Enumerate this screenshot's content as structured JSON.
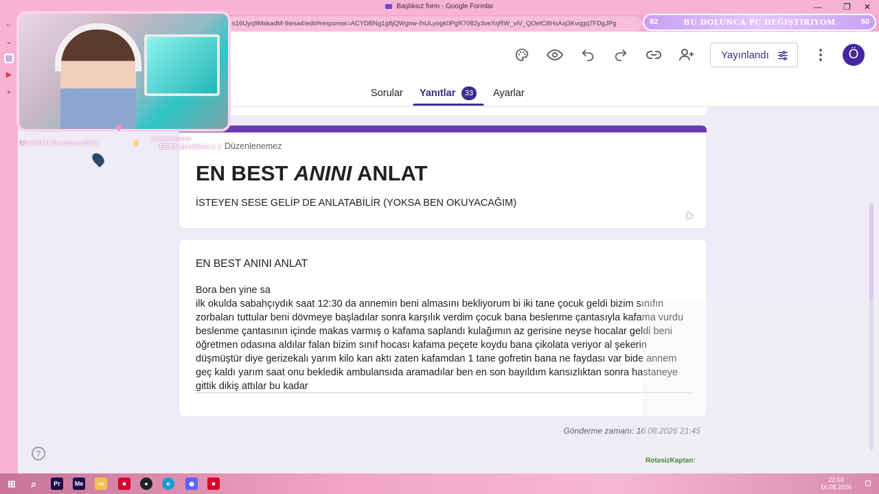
{
  "window": {
    "title": "Başlıksız form - Google Formlar",
    "url": "s16Uyq9MskadM-9iesa4/edit#response=ACYDBNg1g8jQWgnw-IhULyogk0PgR7082y3veXrjRW_viV_QOefC8HsAxj3Kvqgq7FDgJPg"
  },
  "stream_overlay": {
    "goal_left": "82",
    "goal_text": "BU DOLUNCA PC DEĞIŞTIRIYOM",
    "goal_right": "50",
    "label_a": "Abonelik Hediyecisi erenbaha",
    "label_b": "MEKANIN SAHIBI",
    "label_c": "EREN BAHAAA x 1",
    "chat_user": "RotasizKaptan:",
    "chat_msg": "..."
  },
  "toolbar": {
    "publish_label": "Yayınlandı",
    "avatar_letter": "Ö"
  },
  "tabs": {
    "questions": "Sorular",
    "responses": "Yanıtlar",
    "responses_count": "33",
    "settings": "Ayarlar"
  },
  "form": {
    "noneditable_note": "Düzenlenemez",
    "title_part1": "EN BEST ",
    "title_part2": "ANINI",
    "title_part3": " ANLAT",
    "description": "İSTEYEN SESE GELİP DE ANLATABİLİR (YOKSA BEN OKUYACAĞIM)"
  },
  "response": {
    "question": "EN BEST ANINI ANLAT",
    "answer_line1": "Bora ben yine sa",
    "answer_line2": "ilk okulda sabahçıydık saat 12:30 da annemin beni almasını bekliyorum bi iki tane çocuk geldi bizim sınıfın zorbaları tuttular beni dövmeye başladılar sonra karşılık verdim çocuk bana beslenme çantasıyla kafama vurdu beslenme çantasının içinde makas varmış o kafama saplandı kulağımın az gerisine neyse hocalar geldi beni öğretmen odasına aldılar falan bizim sınıf hocası kafama peçete koydu bana çikolata veriyor al şekerin düşmüştür diye gerizekalı yarım kilo kan aktı zaten kafamdan 1 tane gofretin bana ne faydası var bide annem geç kaldı yarım saat onu bekledik ambulansıda aramadılar ben en son bayıldım kansızlıktan sonra hastaneye gittik dikiş attılar bu kadar",
    "timestamp": "Gönderme zamanı: 16.08.2026 21:45"
  },
  "taskbar": {
    "time": "22:03",
    "date": "16.08.2026"
  },
  "colors": {
    "accent": "#673ab7",
    "brand_dark": "#3d2c8d",
    "page_bg": "#f0ebf8",
    "frame_pink": "#f3a8d0"
  }
}
